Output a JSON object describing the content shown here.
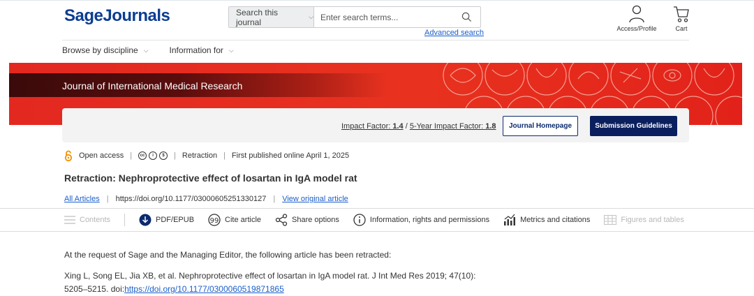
{
  "header": {
    "logo_sage": "Sage",
    "logo_journals": "Journals",
    "search_scope": "Search this journal",
    "search_placeholder": "Enter search terms...",
    "advanced_search": "Advanced search",
    "account_label": "Access/Profile",
    "cart_label": "Cart"
  },
  "nav": {
    "items": [
      {
        "label": "Browse by discipline"
      },
      {
        "label": "Information for"
      }
    ]
  },
  "banner": {
    "journal_name": "Journal of International Medical Research",
    "impact_factor_label": "Impact Factor:",
    "impact_factor_value": "1.4",
    "five_year_label": "5-Year Impact Factor:",
    "five_year_value": "1.8",
    "homepage_button": "Journal Homepage",
    "guidelines_button": "Submission Guidelines"
  },
  "article": {
    "access": "Open access",
    "type": "Retraction",
    "published": "First published online April 1, 2025",
    "title": "Retraction: Nephroprotective effect of losartan in IgA model rat",
    "all_articles": "All Articles",
    "doi": "https://doi.org/10.1177/03000605251330127",
    "view_original": "View original article"
  },
  "toolbar": {
    "contents": "Contents",
    "pdf": "PDF/EPUB",
    "cite": "Cite article",
    "share": "Share options",
    "info": "Information, rights and permissions",
    "metrics": "Metrics and citations",
    "figures": "Figures and tables"
  },
  "body": {
    "intro": "At the request of Sage and the Managing Editor, the following article has been retracted:",
    "citation": "Xing L, Song EL, Jia XB, et al. Nephroprotective effect of losartan in IgA model rat. J Int Med Res 2019; 47(10): 5205–5215. doi:",
    "citation_doi": "https://doi.org/10.1177/0300060519871865"
  },
  "colors": {
    "brand_blue": "#0b3d91",
    "banner_red": "#e32820",
    "button_navy": "#0b1f5e",
    "link_blue": "#1a5ec9",
    "open_access_orange": "#f39200"
  }
}
